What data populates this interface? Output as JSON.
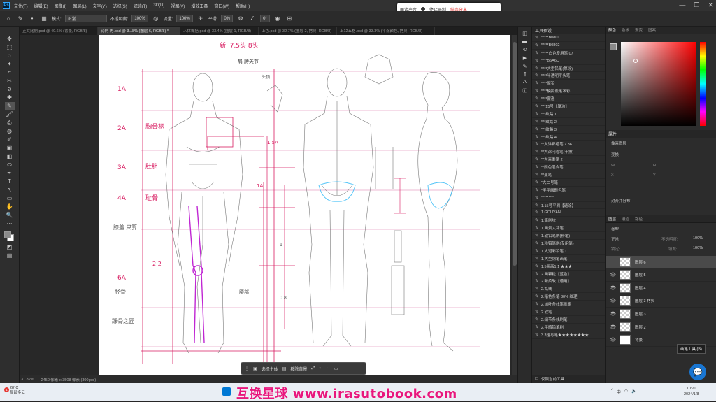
{
  "menu": {
    "logo": "Ps",
    "items": [
      "文件(F)",
      "编辑(E)",
      "图像(I)",
      "图层(L)",
      "文字(Y)",
      "选择(S)",
      "滤镜(T)",
      "3D(D)",
      "视图(V)",
      "增效工具",
      "窗口(W)",
      "帮助(H)"
    ],
    "window_controls": [
      "—",
      "❐",
      "✕"
    ]
  },
  "recorder": {
    "label1": "面谈声音",
    "label2": "停止录制",
    "label3": "结束分享"
  },
  "options_bar": {
    "mode_label": "模式:",
    "mode_value": "正常",
    "opacity_label": "不透明度:",
    "opacity_value": "100%",
    "flow_label": "流量:",
    "flow_value": "100%",
    "smooth_label": "平滑:",
    "smooth_value": "0%",
    "angle_value": "0°"
  },
  "tabs": [
    {
      "label": "正文比例.psd @ 49.6% (背景, RGB/8)",
      "active": false
    },
    {
      "label": "比例·男.psd @ 3...8% (图层 6, RGB/8) *",
      "active": true
    },
    {
      "label": "人体概括.psd @ 33.4% (图层 1, RGB/8)",
      "active": false
    },
    {
      "label": "上色.psd @ 32.7% (图层 2, 拷贝, RGB/8)",
      "active": false
    },
    {
      "label": "上12五格.psd @ 33.3% (平涂颜色, 拷贝, RGB/8)",
      "active": false
    }
  ],
  "tools": [
    "✥",
    "⬚",
    "◌",
    "✦",
    "⌗",
    "✂",
    "⊘",
    "✚",
    "✎",
    "🖌",
    "⎙",
    "◍",
    "✐",
    "▣",
    "◧",
    "⬭",
    "✒",
    "T",
    "↖",
    "▭",
    "✋",
    "🔍",
    "···",
    "◩",
    "▤"
  ],
  "canvas": {
    "top_note": "新, 7.5头  8头",
    "label_joint": "肩 膊关节",
    "label_jiegu": "头顶",
    "labels_left": [
      "1A",
      "2A",
      "3A",
      "4A",
      "6A"
    ],
    "label_chest": "胸骨柄",
    "label_navel": "肚脐",
    "label_pubic": "耻骨",
    "label_knee_ratio": "2:2",
    "label_knee": "膝盖 只算",
    "label_shin": "胫骨",
    "label_ankle": "踝骨之匠",
    "label_15a": "1.5A",
    "label_1a": "1A",
    "label_08": "0.8",
    "label_1": "1",
    "label_hip": "腰部"
  },
  "ctx_bar": {
    "item1": "选择主体",
    "item2": "移除背景",
    "more": "···"
  },
  "status": {
    "zoom": "31.82%",
    "doc": "2450 像素 x 3508 像素 (300 ppi)"
  },
  "presets_panel": {
    "title": "工具预设",
    "items": [
      "*****B0801",
      "*****B0802",
      "*****白色专用笔 07",
      "****B6A6C",
      "****大型铅笔(厚涂)",
      "****半透明平头笔",
      "****原铅",
      "****模拟炭笔水彩",
      "****蒙逊",
      "***15号【厚涂】",
      "***纹路 1",
      "***纹路 2",
      "***纹路 3",
      "***纹路 4",
      "**大涂彩蜡笔 7.36",
      "**大涂闩着笔(干擦)",
      "**大素柔笔 2",
      "**颜色混合笔",
      "**蒸笔",
      "*大二号笔",
      "*半平画颜色笔",
      "*********",
      "1.15号平刷【速涂】",
      "1.GOUYAN",
      "1.笔刷块",
      "1.画景大钩笔",
      "1.软铅笔刷(粉笔)",
      "1.粉铅笔刷(专用笔)",
      "1.大道彩铅笔 1",
      "1.大型钢笔画笔",
      "1.5画画1 1 ★★★",
      "2.画颗粒【蓝色】",
      "2.新柔软【通用】",
      "2.乱线",
      "2.暗色条笔 30% 纹理",
      "2.加叶条线笔刷笔",
      "2.软笔",
      "2.细节条线刷笔",
      "2.平暗铅笔刷",
      "3.3速写笔★★★★★★★★"
    ],
    "footer": "仅限当前工具"
  },
  "color_panel": {
    "tabs": [
      "颜色",
      "色板",
      "渐变",
      "图案"
    ],
    "fg_color": "#8a8a8a"
  },
  "properties_panel": {
    "title": "属性",
    "layer_type": "像素图层",
    "transform": "变换",
    "w": "W",
    "h": "H",
    "x": "X",
    "y": "Y",
    "align": "对齐并分布"
  },
  "layers_panel": {
    "tabs": [
      "图层",
      "通道",
      "路径"
    ],
    "filter": "类型",
    "blend": "正常",
    "opacity_label": "不透明度:",
    "opacity": "100%",
    "lock_label": "锁定:",
    "fill_label": "填充:",
    "fill": "100%",
    "layers": [
      {
        "name": "图层 6",
        "selected": true,
        "visible": false
      },
      {
        "name": "图层 5",
        "selected": false,
        "visible": true
      },
      {
        "name": "图层 4",
        "selected": false,
        "visible": true
      },
      {
        "name": "图层 3 拷贝",
        "selected": false,
        "visible": true
      },
      {
        "name": "图层 3",
        "selected": false,
        "visible": true
      },
      {
        "name": "图层 2",
        "selected": false,
        "visible": true
      },
      {
        "name": "背景",
        "selected": false,
        "visible": true
      }
    ]
  },
  "tooltip": "画笔工具 (B)",
  "taskbar": {
    "temp": "28°C",
    "weather": "局部多云",
    "badge": "1",
    "watermark": "互换星球 www.irasutobook.com",
    "tray_lang": "中",
    "time": "10:20",
    "date": "2024/1/8"
  },
  "colors": {
    "accent": "#31a8ff",
    "watermark": "#e8177d",
    "guide_pink": "#d81b60",
    "guide_purple": "#c026d3"
  }
}
